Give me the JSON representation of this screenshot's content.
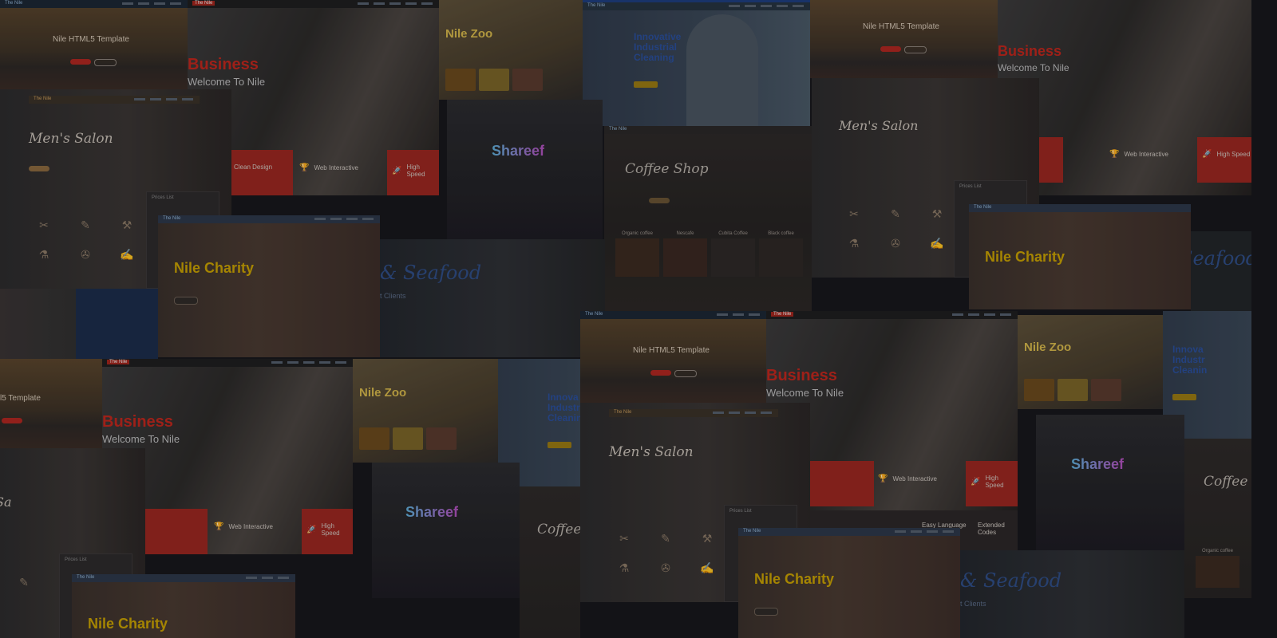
{
  "templates": {
    "nile_html5": {
      "title": "Nile HTML5 Template",
      "short_title": "l5 Template",
      "logo": "The Nile"
    },
    "business": {
      "title": "Business",
      "subtitle": "Welcome To Nile",
      "feature_1": "Web Interactive",
      "feature_2": "High Speed",
      "feature_3": "Clean Design",
      "feature_4": "Easy Language",
      "feature_5": "Extended Codes"
    },
    "salon": {
      "title": "Men's Salon",
      "price_list": "Prices List",
      "partial": "Sa"
    },
    "zoo": {
      "title": "Nile Zoo"
    },
    "cleaning": {
      "title": "Innovative Industrial Cleaning",
      "title_short": "Innova Industr Cleanin"
    },
    "shareef": {
      "title": "Shareef"
    },
    "coffee": {
      "title": "Coffee Shop",
      "partial": "Coffee",
      "products": [
        "Organic coffee",
        "Nescafe",
        "Cubita Coffee",
        "Black coffee"
      ]
    },
    "charity": {
      "title": "Nile Charity"
    },
    "seafood": {
      "title": "& Seafood",
      "partial": "Seafood",
      "sub": "t Clients"
    }
  },
  "colors": {
    "background": "#16161a",
    "business_red": "#c0261c",
    "charity_gold": "#c9a100",
    "cleaning_blue": "#1f4a9a",
    "zoo_gold": "#d6b84a",
    "shareef_gradient_start": "#5fb0d8",
    "shareef_gradient_end": "#b44fbd",
    "seafood_blue": "#2f4e86"
  },
  "icons": [
    "trophy-icon",
    "rocket-icon",
    "scissors-icon",
    "razor-icon",
    "comb-icon"
  ]
}
